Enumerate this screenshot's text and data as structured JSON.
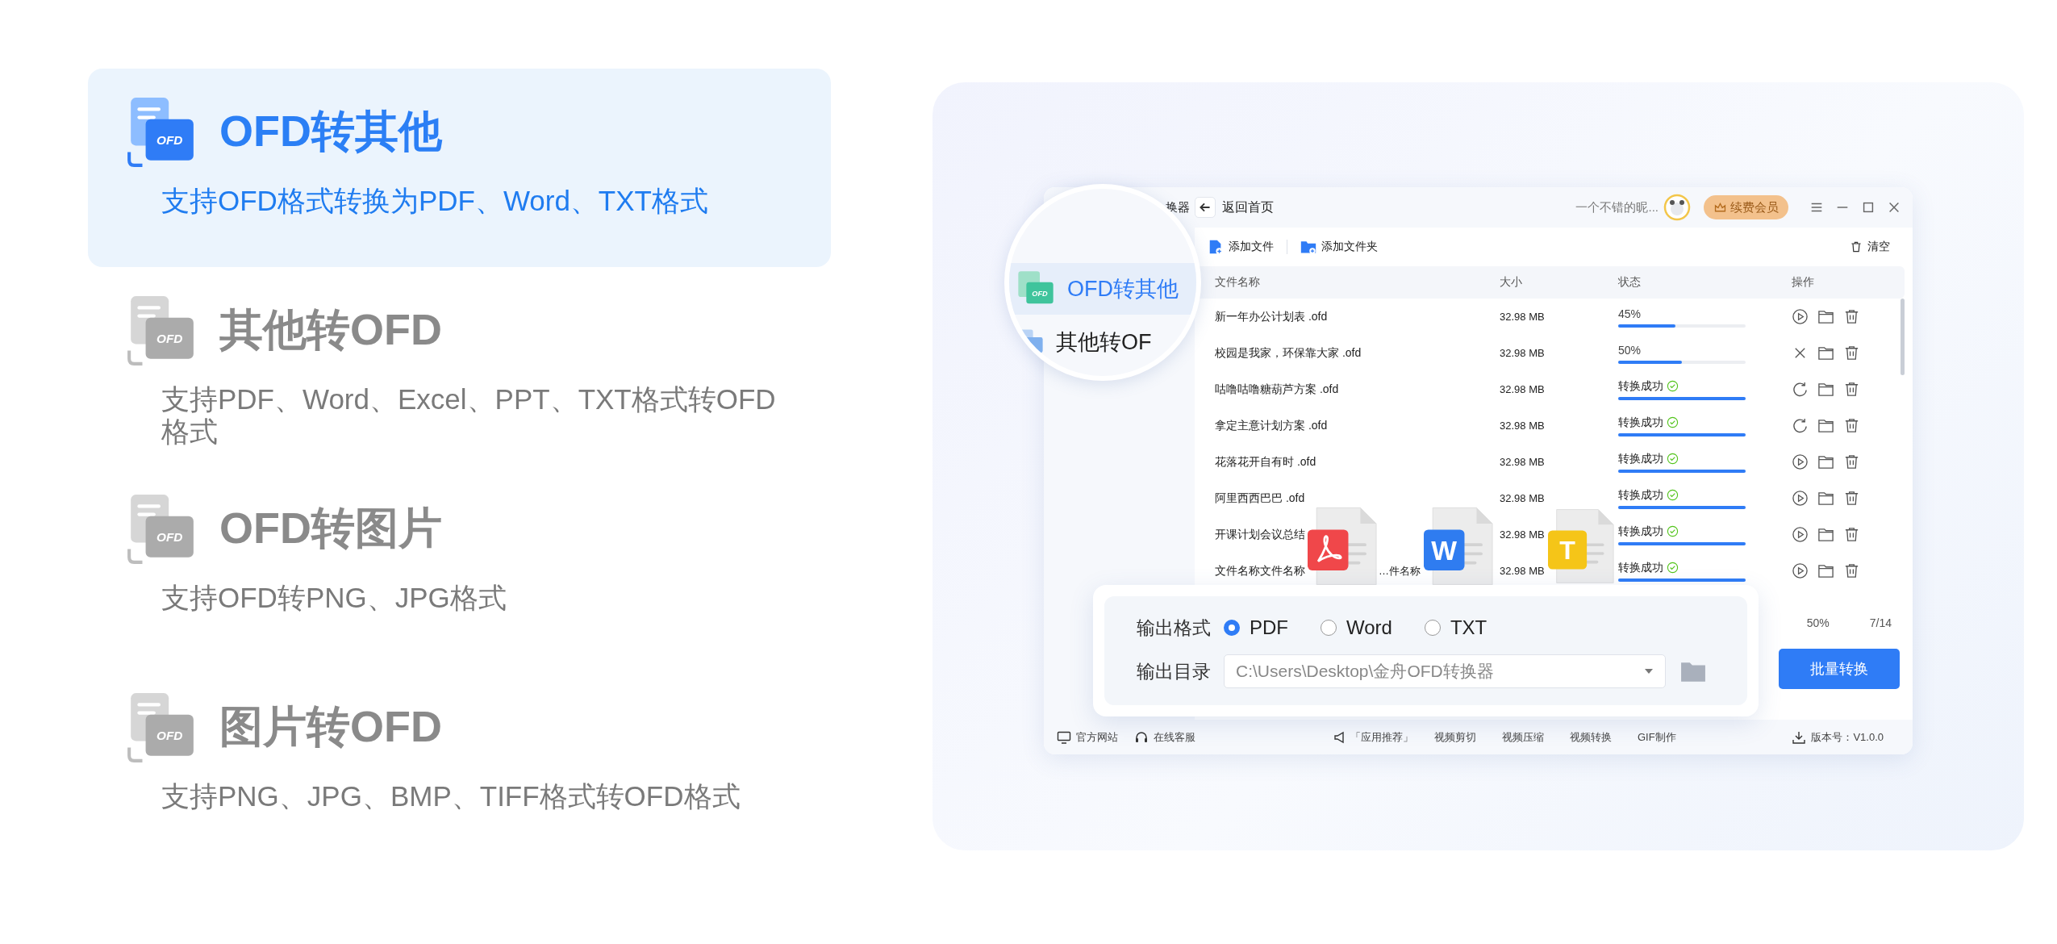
{
  "features": [
    {
      "title": "OFD转其他",
      "description": "支持OFD格式转换为PDF、Word、TXT格式",
      "icon_label": "OFD",
      "selected": true
    },
    {
      "title": "其他转OFD",
      "description": "支持PDF、Word、Excel、PPT、TXT格式转OFD格式",
      "icon_label": "OFD",
      "selected": false
    },
    {
      "title": "OFD转图片",
      "description": "支持OFD转PNG、JPG格式",
      "icon_label": "OFD",
      "selected": false
    },
    {
      "title": "图片转OFD",
      "description": "支持PNG、JPG、BMP、TIFF格式转OFD格式",
      "icon_label": "OFD",
      "selected": false
    }
  ],
  "app": {
    "title": "换器",
    "back": "返回首页",
    "user_name": "一个不错的昵...",
    "vip_button": "续费会员",
    "toolbar": {
      "add_file": "添加文件",
      "add_folder": "添加文件夹",
      "clear": "清空"
    },
    "columns": [
      "文件名称",
      "大小",
      "状态",
      "操作"
    ],
    "rows": [
      {
        "name": "新一年办公计划表 .ofd",
        "size": "32.98 MB",
        "kind": "progress",
        "status": "45%",
        "level": 0.45,
        "action": {
          "kind": "play"
        }
      },
      {
        "name": "校园是我家，环保靠大家 .ofd",
        "size": "32.98 MB",
        "kind": "progress",
        "status": "50%",
        "level": 0.5,
        "action": {
          "kind": "cancel"
        }
      },
      {
        "name": "咕噜咕噜糖葫芦方案 .ofd",
        "size": "32.98 MB",
        "kind": "done",
        "status": "转换成功",
        "level": 1,
        "action": {
          "kind": "retry"
        }
      },
      {
        "name": "拿定主意计划方案 .ofd",
        "size": "32.98 MB",
        "kind": "done",
        "status": "转换成功",
        "level": 1,
        "action": {
          "kind": "retry"
        }
      },
      {
        "name": "花落花开自有时 .ofd",
        "size": "32.98 MB",
        "kind": "done",
        "status": "转换成功",
        "level": 1,
        "action": {
          "kind": "play"
        }
      },
      {
        "name": "阿里西西巴巴 .ofd",
        "size": "32.98 MB",
        "kind": "done",
        "status": "转换成功",
        "level": 1,
        "action": {
          "kind": "play"
        }
      },
      {
        "name": "开课计划会议总结",
        "size": "32.98 MB",
        "kind": "done",
        "status": "转换成功",
        "level": 1,
        "action": {
          "kind": "play"
        }
      },
      {
        "name": "文件名称文件名称",
        "name_tail": "…件名称",
        "size": "32.98 MB",
        "kind": "done",
        "status": "转换成功",
        "level": 1,
        "action": {
          "kind": "play"
        }
      }
    ],
    "summary": {
      "percent": "50%",
      "count": "7/14"
    },
    "convert_button": "批量转换",
    "footer": {
      "links": [
        {
          "kind": "website",
          "label": "官方网站"
        },
        {
          "kind": "support",
          "label": "在线客服"
        }
      ],
      "recommend": "「应用推荐」",
      "apps": [
        "视频剪切",
        "视频压缩",
        "视频转换",
        "GIF制作"
      ],
      "version": "版本号：V1.0.0"
    }
  },
  "magnifier": [
    {
      "label": "OFD转其他",
      "icon_label": "OFD",
      "selected": true
    },
    {
      "label": "其他转OF",
      "selected": false
    }
  ],
  "file_icons": [
    {
      "kind": "pdf"
    },
    {
      "kind": "word",
      "letter": "W"
    },
    {
      "kind": "txt",
      "letter": "T"
    }
  ],
  "output_panel": {
    "format_label": "输出格式",
    "formats": [
      {
        "label": "PDF",
        "selected": true
      },
      {
        "label": "Word",
        "selected": false
      },
      {
        "label": "TXT",
        "selected": false
      }
    ],
    "dir_label": "输出目录",
    "dir_value": "C:\\Users\\Desktop\\金舟OFD转换器"
  }
}
